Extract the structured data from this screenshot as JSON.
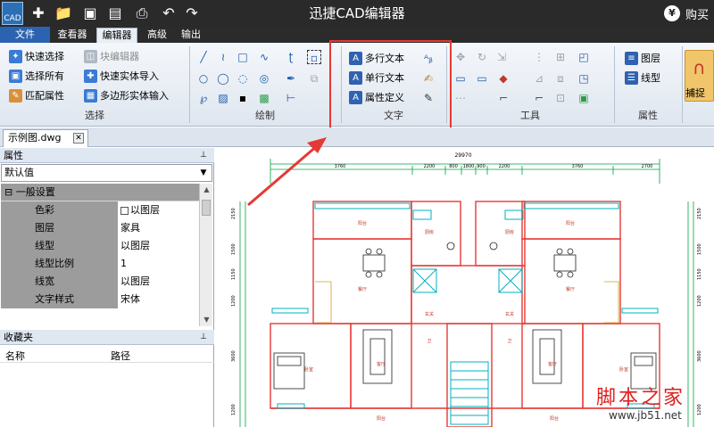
{
  "window": {
    "title": "迅捷CAD编辑器",
    "logo_text": "CAD",
    "buy_label": "购买",
    "buy_icon": "yen-icon"
  },
  "quick_access": [
    "add-icon",
    "open-folder-icon",
    "save-icon",
    "save-as-icon",
    "print-icon",
    "undo-icon",
    "redo-icon"
  ],
  "ribbon_tabs": [
    {
      "label": "文件",
      "state": "file"
    },
    {
      "label": "查看器",
      "state": "normal"
    },
    {
      "label": "编辑器",
      "state": "active"
    },
    {
      "label": "高级",
      "state": "normal"
    },
    {
      "label": "输出",
      "state": "normal"
    }
  ],
  "ribbon": {
    "select_group": {
      "label": "选择",
      "quick_select": "快速选择",
      "select_all": "选择所有",
      "match_props": "匹配属性",
      "block_editor": "块编辑器",
      "quick_entity_import": "快速实体导入",
      "polygon_entity_input": "多边形实体输入"
    },
    "draw_group": {
      "label": "绘制"
    },
    "text_group": {
      "label": "文字",
      "mtext": "多行文本",
      "stext": "单行文本",
      "attdef": "属性定义"
    },
    "tools_group": {
      "label": "工具"
    },
    "props_group": {
      "label": "属性",
      "layer": "图层",
      "linetype": "线型"
    },
    "capture_label": "捕捉"
  },
  "document": {
    "tab_label": "示例图.dwg",
    "close_icon": "close-icon"
  },
  "properties_panel": {
    "title": "属性",
    "pin": "pin-icon",
    "selector_value": "默认值",
    "category": "一般设置",
    "rows": [
      {
        "key": "色彩",
        "value": "以图层",
        "swatch": true
      },
      {
        "key": "图层",
        "value": "家具"
      },
      {
        "key": "线型",
        "value": "以图层"
      },
      {
        "key": "线型比例",
        "value": "1"
      },
      {
        "key": "线宽",
        "value": "以图层"
      },
      {
        "key": "文字样式",
        "value": "宋体"
      }
    ]
  },
  "favorites_panel": {
    "title": "收藏夹",
    "col_name": "名称",
    "col_path": "路径"
  },
  "drawing": {
    "total_dim": "29970",
    "top_dims": [
      "3760",
      "2200",
      "800",
      "1800",
      "900",
      "2200",
      "3760",
      "2700"
    ],
    "room_labels": {
      "balcony_left": "阳台",
      "balcony_right": "阳台",
      "kitchen_left": "厨房",
      "kitchen_right": "厨房",
      "dining_left": "餐厅",
      "dining_right": "餐厅",
      "hall_left": "玄关",
      "hall_right": "玄关",
      "living_left": "客厅",
      "living_right": "客厅",
      "bedroom_left": "卧室",
      "bedroom_right": "卧室",
      "bath_left": "卫",
      "bath_right": "卫",
      "bottom_left": "阳台",
      "bottom_right": "阳台"
    },
    "left_dims": [
      "2150",
      "1500",
      "1150",
      "1200",
      "3600",
      "1200"
    ],
    "right_dims": [
      "2150",
      "1500",
      "1150",
      "1200",
      "3600",
      "1200"
    ]
  },
  "watermark": {
    "main": "脚本之家",
    "sub": "www.jb51.net"
  },
  "colors": {
    "title_bar": "#2a2a2a",
    "file_tab": "#2c63b0",
    "highlight": "#e53935",
    "wall_red": "#e53935",
    "cyan_line": "#00b0c0",
    "dim_green": "#00a040"
  }
}
